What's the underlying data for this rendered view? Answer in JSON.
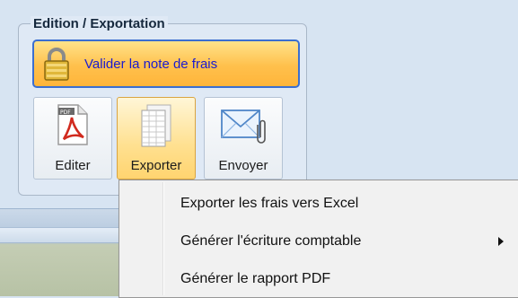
{
  "group": {
    "title": "Edition / Exportation"
  },
  "validate_button": {
    "label": "Valider la note de frais",
    "icon": "lock-icon"
  },
  "buttons": [
    {
      "label": "Editer",
      "icon": "pdf-file-icon"
    },
    {
      "label": "Exporter",
      "icon": "spreadsheet-icon"
    },
    {
      "label": "Envoyer",
      "icon": "mail-attachment-icon"
    }
  ],
  "menu": {
    "items": [
      {
        "label": "Exporter les frais vers Excel",
        "submenu": false
      },
      {
        "label": "Générer l'écriture comptable",
        "submenu": true
      },
      {
        "label": "Générer le rapport PDF",
        "submenu": false
      }
    ]
  },
  "colors": {
    "accent_border": "#3b6fd0",
    "validate_text": "#1a1ad0",
    "active_button": "#ffe08f",
    "validate_fill": "#ffc04c"
  }
}
